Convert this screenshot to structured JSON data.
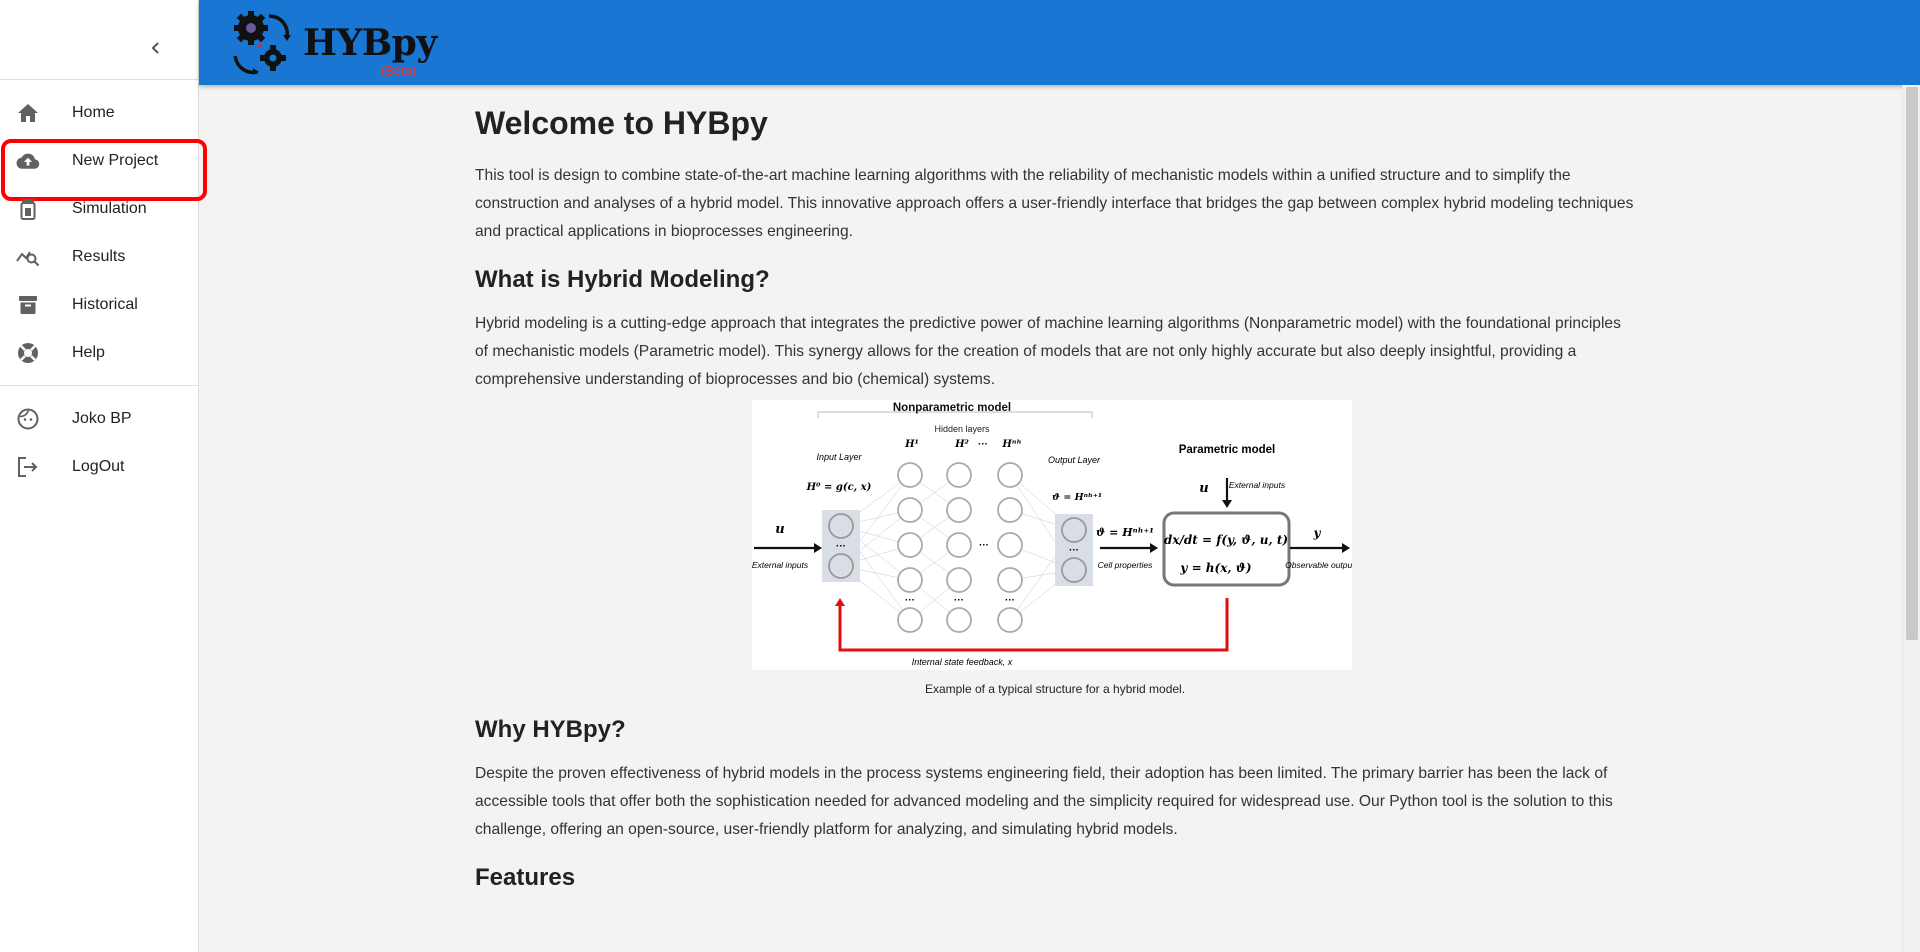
{
  "sidebar": {
    "collapse_icon": "chevron-left-icon",
    "items": [
      {
        "label": "Home",
        "icon": "home-icon"
      },
      {
        "label": "New Project",
        "icon": "cloud-upload-icon"
      },
      {
        "label": "Simulation",
        "icon": "simulation-icon"
      },
      {
        "label": "Results",
        "icon": "results-icon"
      },
      {
        "label": "Historical",
        "icon": "archive-icon"
      },
      {
        "label": "Help",
        "icon": "help-icon"
      }
    ],
    "account": [
      {
        "label": "Joko BP",
        "icon": "user-face-icon"
      },
      {
        "label": "LogOut",
        "icon": "logout-icon"
      }
    ],
    "highlighted_item": "New Project"
  },
  "header": {
    "brand_name": "HYBpy",
    "brand_badge": "(Beta)",
    "bg_color": "#1976d2"
  },
  "main": {
    "title": "Welcome to HYBpy",
    "intro": "This tool is design to combine state-of-the-art machine learning algorithms with the reliability of mechanistic models within a unified structure and to simplify the construction and analyses of a hybrid model. This innovative approach offers a user-friendly interface that bridges the gap between complex hybrid modeling techniques and practical applications in bioprocesses engineering.",
    "section1_title": "What is Hybrid Modeling?",
    "section1_text": "Hybrid modeling is a cutting-edge approach that integrates the predictive power of machine learning algorithms (Nonparametric model) with the foundational principles of mechanistic models (Parametric model). This synergy allows for the creation of models that are not only highly accurate but also deeply insightful, providing a comprehensive understanding of bioprocesses and bio (chemical) systems.",
    "figure": {
      "caption": "Example of a typical structure for a hybrid model.",
      "nonparametric_label": "Nonparametric model",
      "hidden_layers_label": "Hidden layers",
      "input_layer_label": "Input Layer",
      "output_layer_label": "Output Layer",
      "parametric_label": "Parametric model",
      "external_inputs_label": "External inputs",
      "cell_properties_label": "Cell properties",
      "observable_outputs_label": "Observable outputs",
      "feedback_label": "Internal state feedback, x",
      "eq1": "dx/dt = f(y, ϑ, u, t)",
      "eq2": "y = h(x, ϑ)",
      "h0": "H⁰ = g(c, x)",
      "theta": "ϑ = Hⁿʰ⁺¹",
      "h1": "H¹",
      "h2": "H²",
      "hnh": "Hⁿʰ",
      "u": "u",
      "y": "y",
      "ellipsis": "···"
    },
    "section2_title": "Why HYBpy?",
    "section2_text": "Despite the proven effectiveness of hybrid models in the process systems engineering field, their adoption has been limited. The primary barrier has been the lack of accessible tools that offer both the sophistication needed for advanced modeling and the simplicity required for widespread use. Our Python tool is the solution to this challenge, offering an open-source, user-friendly platform for analyzing, and simulating hybrid models.",
    "section3_title": "Features"
  }
}
